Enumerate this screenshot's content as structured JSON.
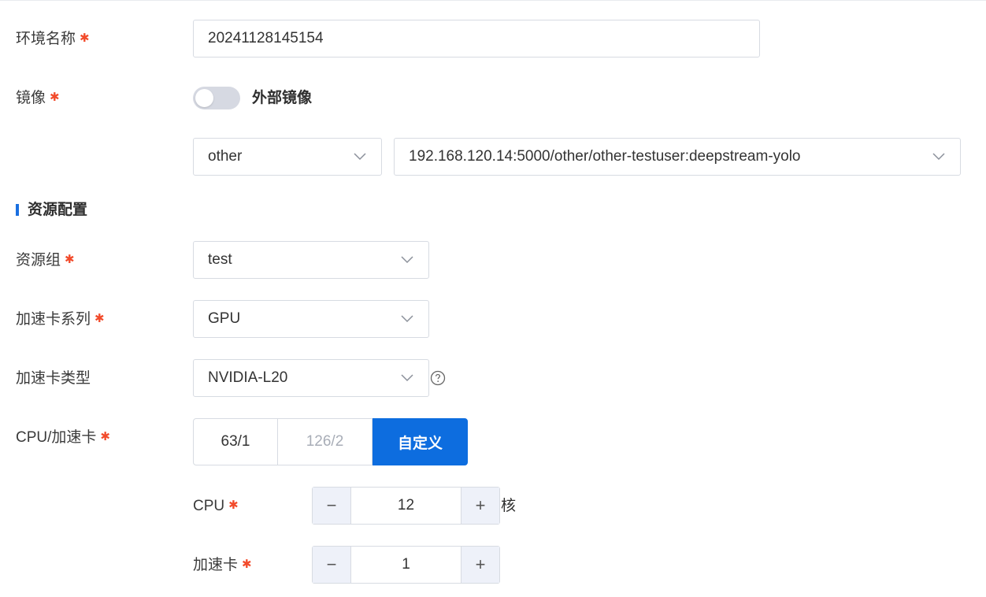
{
  "env_name": {
    "label": "环境名称",
    "value": "20241128145154"
  },
  "image": {
    "label": "镜像",
    "external_toggle_label": "外部镜像",
    "external_toggle_on": false,
    "repo_select": "other",
    "image_select": "192.168.120.14:5000/other/other-testuser:deepstream-yolo"
  },
  "resource_section": {
    "title": "资源配置"
  },
  "resource_group": {
    "label": "资源组",
    "value": "test"
  },
  "accelerator_series": {
    "label": "加速卡系列",
    "value": "GPU"
  },
  "accelerator_type": {
    "label": "加速卡类型",
    "value": "NVIDIA-L20"
  },
  "cpu_accel": {
    "label": "CPU/加速卡",
    "options": [
      "63/1",
      "126/2",
      "自定义"
    ],
    "selected": "自定义"
  },
  "cpu": {
    "label": "CPU",
    "value": "12",
    "unit": "核",
    "minus": "−",
    "plus": "+"
  },
  "accelerator": {
    "label": "加速卡",
    "value": "1",
    "minus": "−",
    "plus": "+"
  },
  "required_mark": "✱",
  "colors": {
    "accent": "#0d6ddf",
    "required": "#f24b2b",
    "border": "#d7dbe2",
    "toggle_off": "#d6d9e2"
  }
}
